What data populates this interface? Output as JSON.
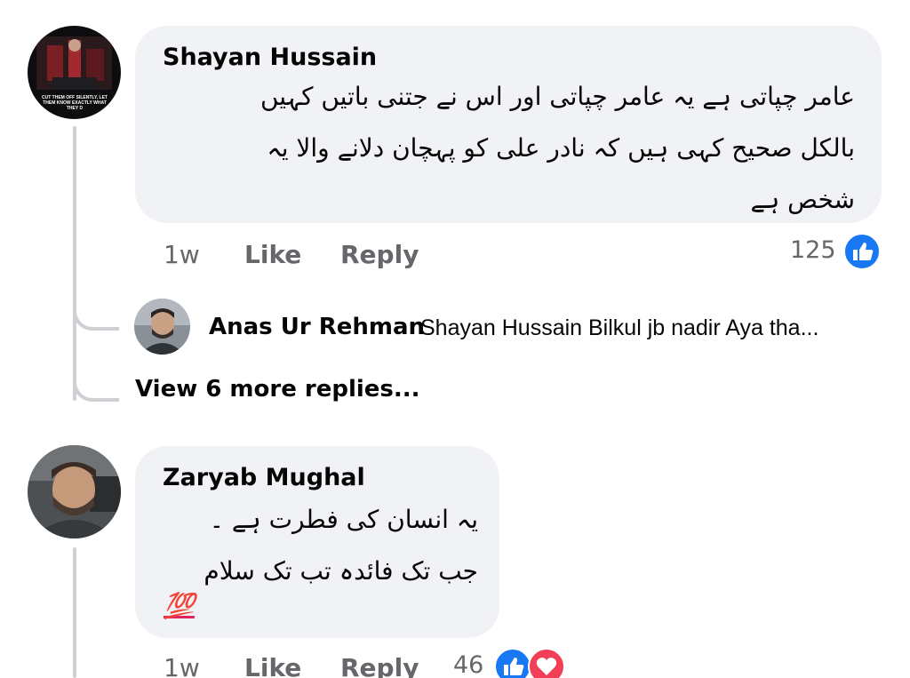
{
  "comments": [
    {
      "author": "Shayan Hussain",
      "lines": [
        "عامر چپاتی ہے یہ عامر چپاتی اور اس نے جتنی باتیں کہیں",
        "بالکل صحیح کہی ہیں کہ نادر علی کو پہچان دلانے والا یہ",
        "شخص ہے"
      ],
      "time": "1w",
      "like_label": "Like",
      "reply_label": "Reply",
      "reaction_count": "125",
      "reactions": [
        "like-icon"
      ]
    },
    {
      "author": "Zaryab Mughal",
      "lines": [
        "یہ انسان کی فطرت ہے ۔",
        "جب تک فائدہ تب تک سلام"
      ],
      "emoji": "💯",
      "time": "1w",
      "like_label": "Like",
      "reply_label": "Reply",
      "reaction_count": "46",
      "reactions": [
        "like-icon",
        "love-icon"
      ]
    }
  ],
  "reply_preview": {
    "author": "Anas Ur Rehman",
    "snippet": "Shayan Hussain Bilkul jb nadir Aya tha..."
  },
  "view_more": "View 6 more replies...",
  "avatar_caption": "CUT THEM OFF SILENTLY, LET THEM KNOW EXACTLY WHAT THEY D",
  "colors": {
    "bubble": "#f0f2f5",
    "meta_text": "#65676b",
    "like_blue": "#1877f2",
    "love_red": "#f33e58",
    "thread_line": "#ced0d4"
  }
}
